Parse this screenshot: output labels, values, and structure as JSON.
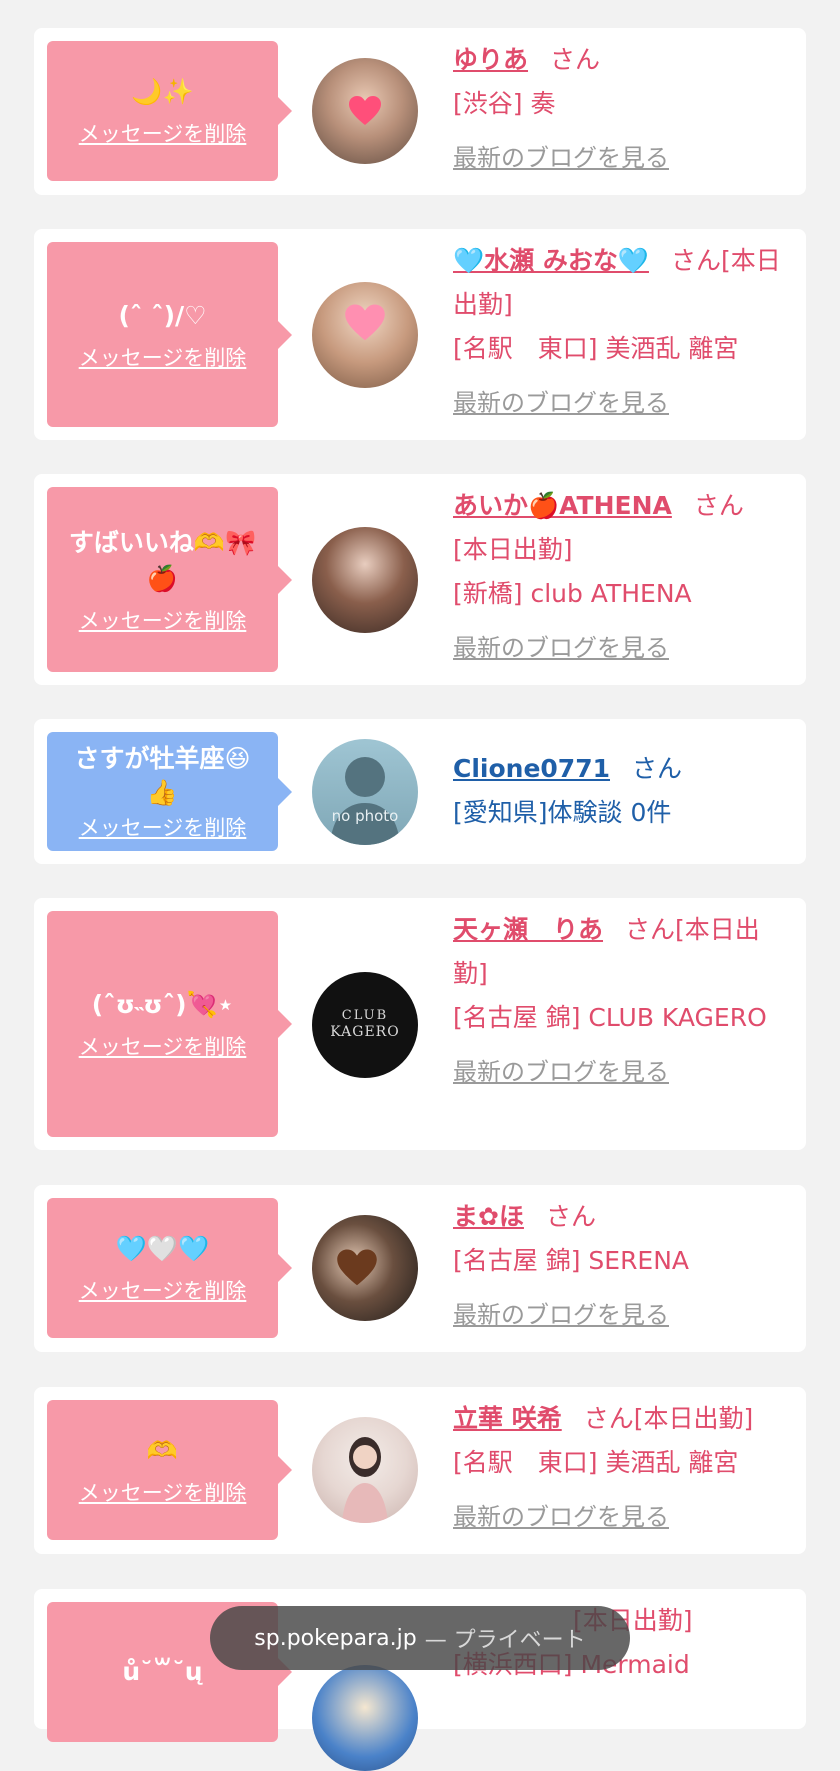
{
  "delete_label": "メッセージを削除",
  "blog_label": "最新のブログを見る",
  "san_label": "さん",
  "cards": [
    {
      "message": "🌙✨",
      "name": "ゆりあ",
      "suffix": "",
      "line2": "[渋谷] 奏",
      "line3": ""
    },
    {
      "message": "(ˆ ˆ)/♡",
      "name": "🩵水瀬 みおな🩵",
      "suffix": "[本日出勤]",
      "line2": "[名駅　東口] 美酒乱 離宮",
      "line3": ""
    },
    {
      "message": "すばいいね🫶🎀🍎",
      "name": "あいか🍎ATHENA",
      "suffix": "",
      "line2": "[本日出勤]",
      "line3": "[新橋] club ATHENA"
    },
    {
      "message": "さすが牡羊座😆👍",
      "name": "Clione0771",
      "suffix": "",
      "line2": "[愛知県]体験談 0件",
      "line3": ""
    },
    {
      "message": "(ˆʊ˵ʊˆ)💘⋆",
      "name": "天ヶ瀬　りあ",
      "suffix": "[本日出勤]",
      "line2": "[名古屋 錦] CLUB KAGERO",
      "line3": ""
    },
    {
      "message": "🩵🤍🩵",
      "name": "ま✿ほ",
      "suffix": "",
      "line2": "[名古屋 錦] SERENA",
      "line3": ""
    },
    {
      "message": "🫶",
      "name": "立華 咲希",
      "suffix": "[本日出勤]",
      "line2": "[名駅　東口] 美酒乱 離宮",
      "line3": ""
    },
    {
      "message": "ů˘꒳˘ų",
      "name": "[本日出勤]",
      "suffix": "",
      "line2": "[横浜西口] Mermaid",
      "line3": ""
    }
  ],
  "avatar_text": {
    "no_photo": "no photo",
    "club_name": "CLUB",
    "club_sub": "KAGERO"
  },
  "browser": {
    "domain": "sp.pokepara.jp",
    "mode": "— プライベート"
  },
  "colors": {
    "pink_bubble": "#f799a8",
    "blue_bubble": "#8ab4f4",
    "name_pink": "#e04c6c",
    "name_blue": "#1f5fa8"
  }
}
